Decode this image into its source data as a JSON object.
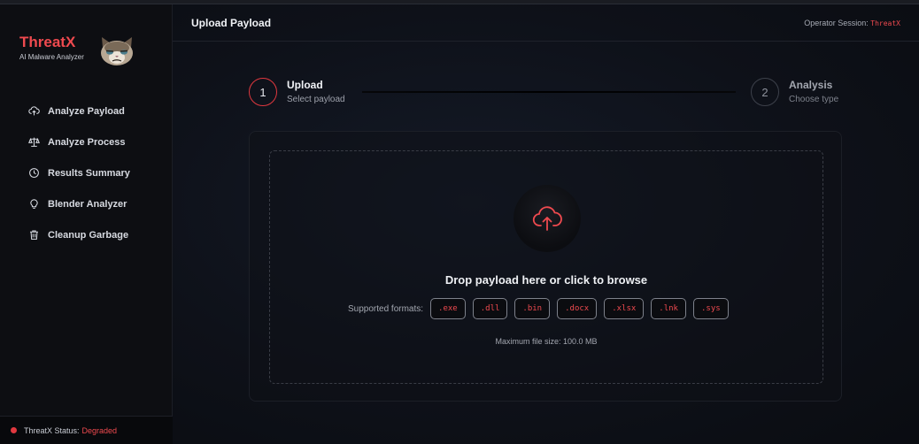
{
  "brand": {
    "name": "ThreatX",
    "subtitle": "AI Malware Analyzer"
  },
  "sidebar": {
    "items": [
      {
        "label": "Analyze Payload",
        "icon": "cloud-upload-icon"
      },
      {
        "label": "Analyze Process",
        "icon": "scale-icon"
      },
      {
        "label": "Results Summary",
        "icon": "clock-icon"
      },
      {
        "label": "Blender Analyzer",
        "icon": "lightbulb-icon"
      },
      {
        "label": "Cleanup Garbage",
        "icon": "trash-icon"
      }
    ]
  },
  "status": {
    "label": "ThreatX Status:",
    "value": "Degraded",
    "color": "#e0383f"
  },
  "header": {
    "title": "Upload Payload",
    "session_label": "Operator Session:",
    "session_user": "ThreatX"
  },
  "stepper": {
    "steps": [
      {
        "number": "1",
        "title": "Upload",
        "subtitle": "Select payload",
        "active": true
      },
      {
        "number": "2",
        "title": "Analysis",
        "subtitle": "Choose type",
        "active": false
      }
    ]
  },
  "upload": {
    "title": "Drop payload here or click to browse",
    "formats_label": "Supported formats:",
    "formats": [
      ".exe",
      ".dll",
      ".bin",
      ".docx",
      ".xlsx",
      ".lnk",
      ".sys"
    ],
    "max_size": "Maximum file size: 100.0 MB"
  },
  "colors": {
    "accent": "#ef4a4f",
    "background": "#0b0d13"
  }
}
